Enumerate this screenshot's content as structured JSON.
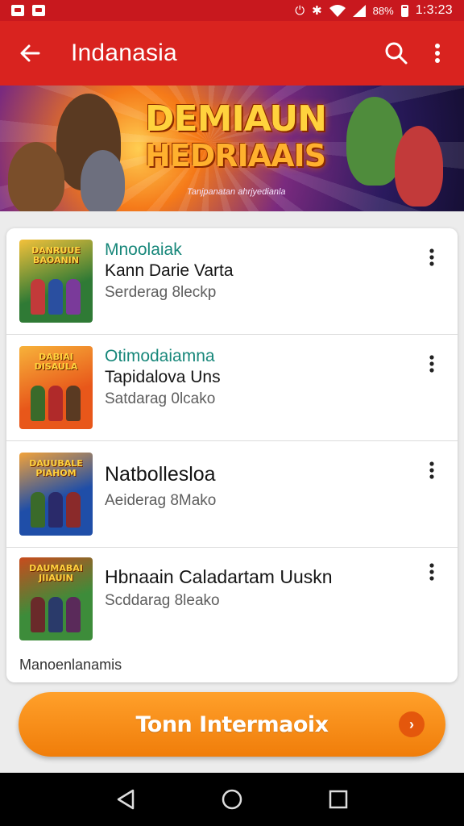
{
  "status_bar": {
    "battery_text": "88%",
    "time": "1:3:23"
  },
  "app_bar": {
    "title": "Indanasia"
  },
  "banner": {
    "title_line1": "DEMIAUN",
    "title_line2": "HEDRIAAIS",
    "subtitle": "Tanjpanatan ahrjyedianla"
  },
  "games": [
    {
      "category": "Mnoolaiak",
      "title": "Kann Darie Varta",
      "subtitle": "Serderag 8leckp",
      "thumb_logo": "DANRUUE BAOANIN",
      "thumb_colors": [
        "#2f7a35",
        "#f3c13a"
      ]
    },
    {
      "category": "Otimodaiamna",
      "title": "Tapidalova Uns",
      "subtitle": "Satdarag 0lcako",
      "thumb_logo": "DABIAI DISAULA",
      "thumb_colors": [
        "#e8571a",
        "#f7b23a"
      ]
    },
    {
      "category": "",
      "title": "Natbollesloa",
      "subtitle": "Aeiderag 8Mako",
      "thumb_logo": "DAUUBALE PIAHOM",
      "thumb_colors": [
        "#1f4ea8",
        "#f2a23a"
      ]
    },
    {
      "category": "",
      "title": "Hbnaain Caladartam Uuskn",
      "subtitle": "Scddarag 8leako",
      "thumb_logo": "DAUMABAI JIIAUIN",
      "thumb_colors": [
        "#3d8c3a",
        "#c94b1d"
      ]
    }
  ],
  "section_label": "Manoenlanamis",
  "cta": {
    "label": "Tonn Intermaoix",
    "icon_glyph": "›"
  },
  "colors": {
    "app_bar": "#d9231f",
    "status_bar": "#c8181e",
    "accent_teal": "#17877a",
    "cta_orange": "#f58d14"
  },
  "icons": [
    "back-arrow-icon",
    "search-icon",
    "more-vert-icon",
    "nav-back-icon",
    "nav-home-icon",
    "nav-recents-icon"
  ]
}
